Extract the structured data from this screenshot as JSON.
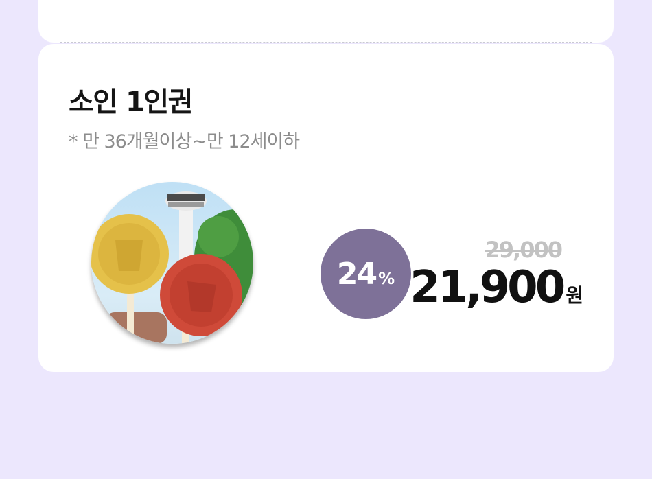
{
  "ticket": {
    "title": "소인 1인권",
    "note": "* 만 36개월이상~만 12세이하",
    "discount": {
      "value": "24",
      "unit": "%"
    },
    "original_price": "29,000",
    "sale_price": "21,900",
    "currency": "원"
  },
  "colors": {
    "page_background": "#ece7fd",
    "card": "#ffffff",
    "discount_badge": "#7e7198",
    "strikethrough_price": "#c2c2c2",
    "sale_price": "#111111"
  }
}
